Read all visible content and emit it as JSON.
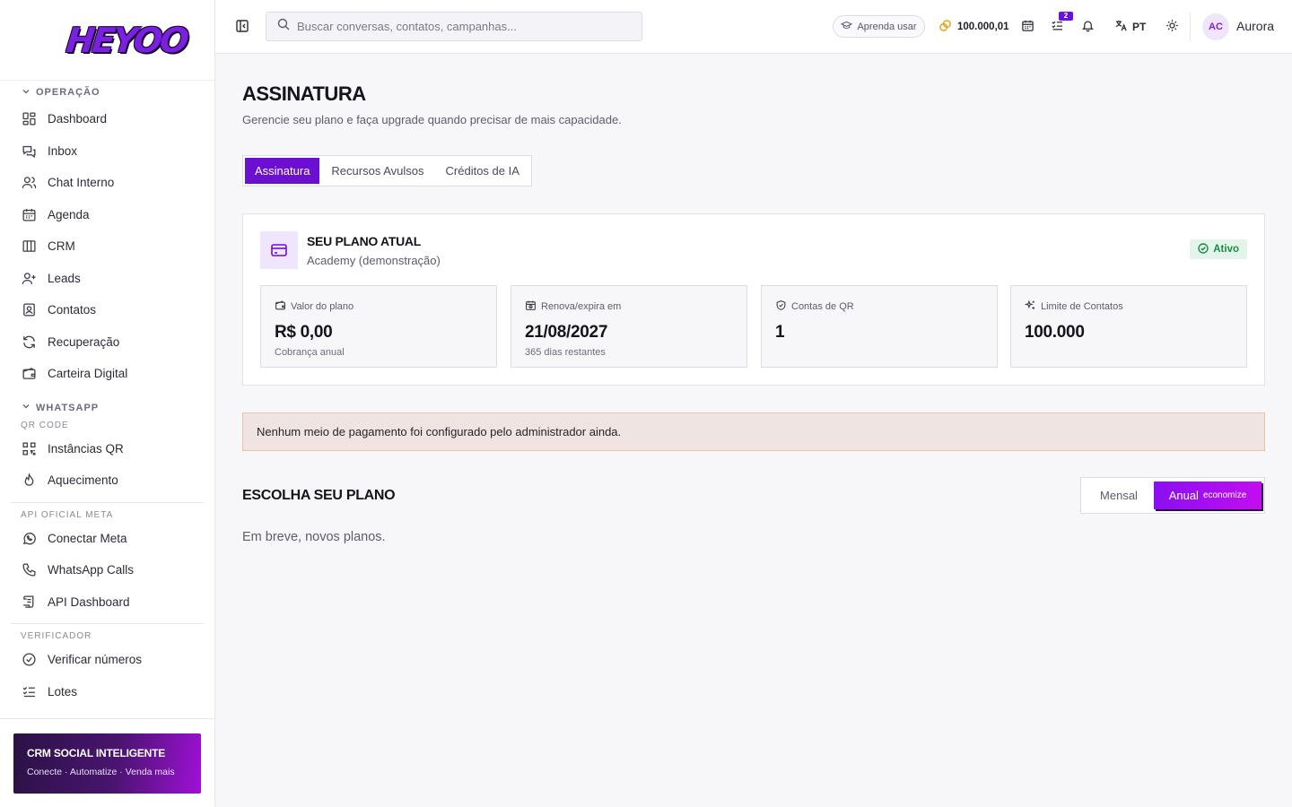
{
  "app": {
    "logo_text": "HEYOO"
  },
  "sidebar": {
    "operacao": {
      "title": "OPERAÇÃO",
      "items": [
        {
          "label": "Dashboard",
          "icon": "dashboard-icon"
        },
        {
          "label": "Inbox",
          "icon": "inbox-icon"
        },
        {
          "label": "Chat Interno",
          "icon": "users-icon"
        },
        {
          "label": "Agenda",
          "icon": "calendar-icon"
        },
        {
          "label": "CRM",
          "icon": "columns-icon"
        },
        {
          "label": "Leads",
          "icon": "user-plus-icon"
        },
        {
          "label": "Contatos",
          "icon": "contact-icon"
        },
        {
          "label": "Recuperação",
          "icon": "refresh-icon"
        },
        {
          "label": "Carteira Digital",
          "icon": "wallet-icon"
        }
      ]
    },
    "whatsapp": {
      "title": "WHATSAPP",
      "qr_label": "QR CODE",
      "qr_items": [
        {
          "label": "Instâncias QR",
          "icon": "qr-icon"
        },
        {
          "label": "Aquecimento",
          "icon": "flame-icon"
        }
      ],
      "meta_label": "API OFICIAL META",
      "meta_items": [
        {
          "label": "Conectar Meta",
          "icon": "whatsapp-icon"
        },
        {
          "label": "WhatsApp Calls",
          "icon": "phone-icon"
        },
        {
          "label": "API Dashboard",
          "icon": "scroll-icon"
        }
      ],
      "verif_label": "VERIFICADOR",
      "verif_items": [
        {
          "label": "Verificar números",
          "icon": "check-circle-icon"
        },
        {
          "label": "Lotes",
          "icon": "list-check-icon"
        }
      ]
    },
    "promo": {
      "title": "CRM SOCIAL INTELIGENTE",
      "subtitle": "Conecte · Automatize · Venda mais"
    }
  },
  "topbar": {
    "search_placeholder": "Buscar conversas, contatos, campanhas...",
    "learn_label": "Aprenda usar",
    "credits": "100.000,01",
    "tasks_badge": "2",
    "language": "PT",
    "avatar_initials": "AC",
    "user_name": "Aurora"
  },
  "page": {
    "title": "ASSINATURA",
    "subtitle": "Gerencie seu plano e faça upgrade quando precisar de mais capacidade.",
    "tabs": [
      "Assinatura",
      "Recursos Avulsos",
      "Créditos de IA"
    ],
    "active_tab": 0
  },
  "plan": {
    "label": "SEU PLANO ATUAL",
    "name": "Academy (demonstração)",
    "status": "Ativo",
    "stats": {
      "valor": {
        "label": "Valor do plano",
        "value": "R$ 0,00",
        "note": "Cobrança anual"
      },
      "renova": {
        "label": "Renova/expira em",
        "value": "21/08/2027",
        "note": "365 dias restantes"
      },
      "contas": {
        "label": "Contas de QR",
        "value": "1"
      },
      "limite": {
        "label": "Limite de Contatos",
        "value": "100.000"
      }
    }
  },
  "alert": {
    "text": "Nenhum meio de pagamento foi configurado pelo administrador ainda."
  },
  "choose": {
    "title": "ESCOLHA SEU PLANO",
    "monthly": "Mensal",
    "annual": "Anual",
    "annual_tag": "economize",
    "empty": "Em breve, novos planos."
  },
  "colors": {
    "accent": "#6b0fd1",
    "success": "#1e8a48",
    "alert_bg": "#f0e4e2"
  }
}
